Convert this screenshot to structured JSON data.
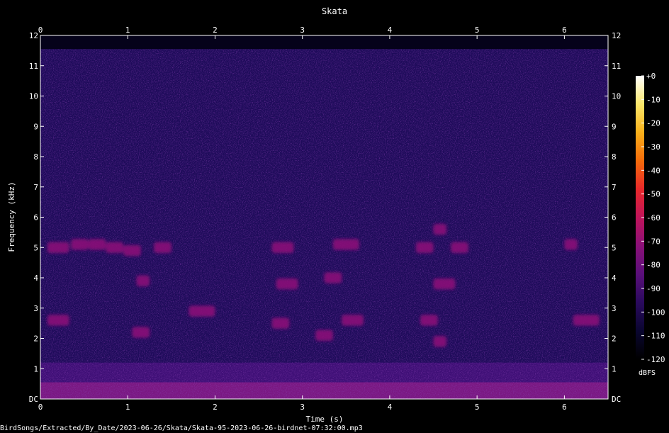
{
  "chart_data": {
    "type": "heatmap",
    "title": "Skata",
    "xlabel": "Time (s)",
    "ylabel": "Frequency (kHz)",
    "xlim": [
      0,
      6.5
    ],
    "ylim": [
      0,
      12
    ],
    "x_ticks": [
      "0",
      "1",
      "2",
      "3",
      "4",
      "5",
      "6"
    ],
    "y_ticks": [
      "DC",
      "1",
      "2",
      "3",
      "4",
      "5",
      "6",
      "7",
      "8",
      "9",
      "10",
      "11",
      "12"
    ],
    "colorbar": {
      "label": "dBFS",
      "range": [
        -120,
        0
      ],
      "ticks": [
        "+0",
        "-10",
        "-20",
        "-30",
        "-40",
        "-50",
        "-60",
        "-70",
        "-80",
        "-90",
        "-100",
        "-110",
        "-120"
      ],
      "colors": [
        "#000000",
        "#0a0630",
        "#2a0a5e",
        "#5a0f7a",
        "#8a1078",
        "#c0145a",
        "#e8282a",
        "#f56b0a",
        "#f9b01a",
        "#fbe76a",
        "#ffffff"
      ]
    },
    "grid": false,
    "legend": "none",
    "calls": [
      {
        "t": 0.08,
        "f": 5.0,
        "dur": 0.25,
        "level": -68
      },
      {
        "t": 0.08,
        "f": 2.6,
        "dur": 0.25,
        "level": -72
      },
      {
        "t": 0.35,
        "f": 5.1,
        "dur": 0.2,
        "level": -72
      },
      {
        "t": 0.55,
        "f": 5.1,
        "dur": 0.2,
        "level": -72
      },
      {
        "t": 0.75,
        "f": 5.0,
        "dur": 0.2,
        "level": -74
      },
      {
        "t": 0.95,
        "f": 4.9,
        "dur": 0.2,
        "level": -74
      },
      {
        "t": 1.1,
        "f": 3.9,
        "dur": 0.15,
        "level": -74
      },
      {
        "t": 1.05,
        "f": 2.2,
        "dur": 0.2,
        "level": -74
      },
      {
        "t": 1.3,
        "f": 5.0,
        "dur": 0.2,
        "level": -74
      },
      {
        "t": 1.7,
        "f": 2.9,
        "dur": 0.3,
        "level": -74
      },
      {
        "t": 2.65,
        "f": 5.0,
        "dur": 0.25,
        "level": -72
      },
      {
        "t": 2.7,
        "f": 3.8,
        "dur": 0.25,
        "level": -76
      },
      {
        "t": 2.65,
        "f": 2.5,
        "dur": 0.2,
        "level": -72
      },
      {
        "t": 3.35,
        "f": 5.1,
        "dur": 0.3,
        "level": -72
      },
      {
        "t": 3.25,
        "f": 4.0,
        "dur": 0.2,
        "level": -74
      },
      {
        "t": 3.15,
        "f": 2.1,
        "dur": 0.2,
        "level": -70
      },
      {
        "t": 3.45,
        "f": 2.6,
        "dur": 0.25,
        "level": -72
      },
      {
        "t": 4.3,
        "f": 5.0,
        "dur": 0.2,
        "level": -68
      },
      {
        "t": 4.5,
        "f": 5.6,
        "dur": 0.15,
        "level": -72
      },
      {
        "t": 4.5,
        "f": 3.8,
        "dur": 0.25,
        "level": -76
      },
      {
        "t": 4.35,
        "f": 2.6,
        "dur": 0.2,
        "level": -74
      },
      {
        "t": 4.5,
        "f": 1.9,
        "dur": 0.15,
        "level": -72
      },
      {
        "t": 4.7,
        "f": 5.0,
        "dur": 0.2,
        "level": -76
      },
      {
        "t": 6.0,
        "f": 5.1,
        "dur": 0.15,
        "level": -72
      },
      {
        "t": 6.1,
        "f": 2.6,
        "dur": 0.3,
        "level": -74
      }
    ]
  },
  "footer": {
    "file_path": "BirdSongs/Extracted/By_Date/2023-06-26/Skata/Skata-95-2023-06-26-birdnet-07:32:00.mp3"
  }
}
